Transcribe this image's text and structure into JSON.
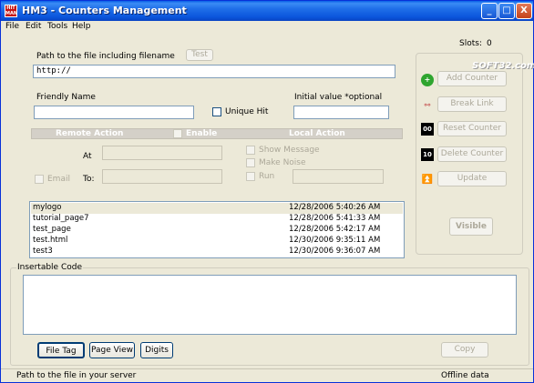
{
  "window": {
    "title": "HM3 - Counters Management",
    "icon_text": "HIT MAN",
    "minimize": "_",
    "maximize": "□",
    "close": "X"
  },
  "menu": [
    "File",
    "Edit",
    "Tools",
    "Help"
  ],
  "slots": {
    "label": "Slots:",
    "value": "0"
  },
  "form": {
    "path_label": "Path to the file including filename",
    "test_button": "Test",
    "path_value": "http://",
    "friendly_name_label": "Friendly Name",
    "friendly_name_value": "",
    "unique_hit_label": "Unique Hit",
    "initial_value_label": "Initial value  *optional",
    "initial_value_value": ""
  },
  "remote": {
    "remote_action_label": "Remote  Action",
    "enable_label": "Enable",
    "local_action_label": "Local  Action",
    "at_label": "At",
    "email_label": "Email",
    "to_label": "To:",
    "show_message_label": "Show Message",
    "make_noise_label": "Make Noise",
    "run_label": "Run"
  },
  "side_buttons": {
    "add_counter": "Add Counter",
    "break_link": "Break Link",
    "reset_counter": "Reset Counter",
    "delete_counter": "Delete Counter",
    "update": "Update",
    "visible": "Visible",
    "reset_icon_text": "00",
    "delete_icon_text": "10",
    "watermark": "SOFT32.com"
  },
  "counters": [
    {
      "name": "mylogo",
      "date": "12/28/2006 5:40:26 AM"
    },
    {
      "name": "tutorial_page7",
      "date": "12/28/2006 5:41:33 AM"
    },
    {
      "name": "test_page",
      "date": "12/28/2006 5:42:17 AM"
    },
    {
      "name": "test.html",
      "date": "12/30/2006 9:35:11 AM"
    },
    {
      "name": "test3",
      "date": "12/30/2006 9:36:07 AM"
    }
  ],
  "code": {
    "frame_label": "Insertable Code",
    "content": "",
    "file_tag_button": "File Tag",
    "page_view_button": "Page View",
    "digits_button": "Digits",
    "copy_button": "Copy"
  },
  "status": {
    "left": "Path to the file in your server",
    "right": "Offline data"
  },
  "colors": {
    "titlebar": "#0b56dc",
    "panel_bg": "#ece9d8",
    "field_border": "#7f9db9",
    "disabled_text": "#aca899"
  }
}
